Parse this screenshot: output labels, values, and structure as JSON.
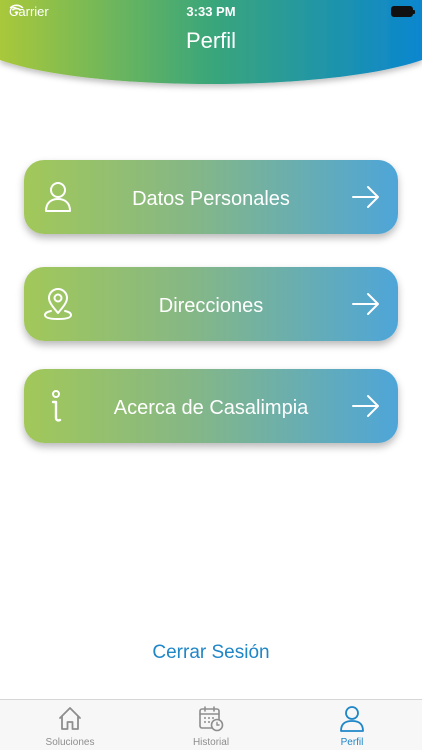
{
  "status_bar": {
    "carrier": "Carrier",
    "time": "3:33 PM"
  },
  "header": {
    "title": "Perfil",
    "gradient_start": "#a9c83a",
    "gradient_end": "#0a86cf"
  },
  "menu": {
    "items": [
      {
        "label": "Datos Personales",
        "icon": "user-icon"
      },
      {
        "label": "Direcciones",
        "icon": "location-pin-icon"
      },
      {
        "label": "Acerca de Casalimpia",
        "icon": "info-icon"
      }
    ],
    "arrow_icon": "arrow-right-icon"
  },
  "logout": {
    "label": "Cerrar Sesión"
  },
  "tabbar": {
    "active_color": "#1f86c7",
    "inactive_color": "#8e8e8e",
    "tabs": [
      {
        "label": "Soluciones",
        "icon": "home-icon",
        "active": false
      },
      {
        "label": "Historial",
        "icon": "calendar-clock-icon",
        "active": false
      },
      {
        "label": "Perfil",
        "icon": "user-icon",
        "active": true
      }
    ]
  }
}
